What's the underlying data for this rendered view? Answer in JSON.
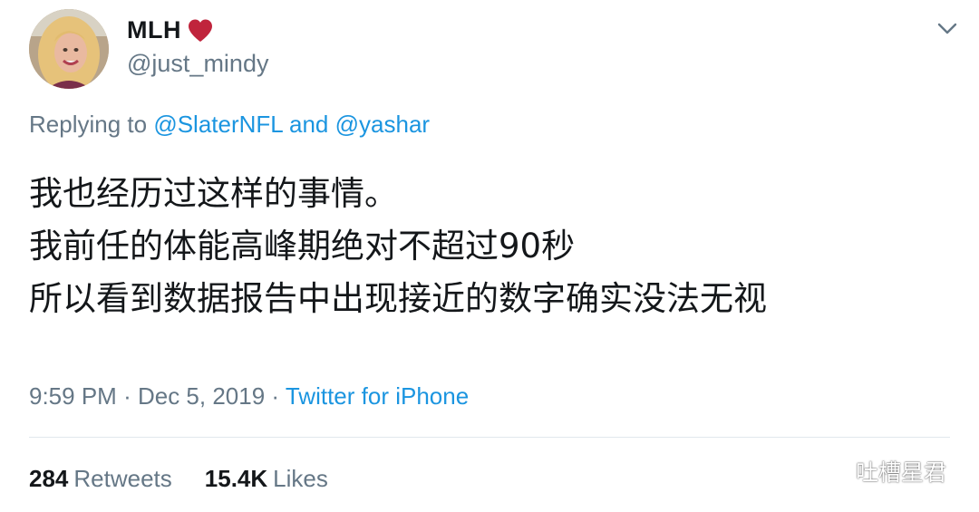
{
  "author": {
    "display_name": "MLH",
    "handle": "@just_mindy",
    "badge_icon": "heart-icon",
    "badge_color": "#c0243c"
  },
  "reply": {
    "prefix": "Replying to",
    "mention_1": "@SlaterNFL",
    "conjunction": "and",
    "mention_2": "@yashar"
  },
  "tweet": {
    "lines": [
      "我也经历过这样的事情。",
      "我前任的体能高峰期绝对不超过90秒",
      "所以看到数据报告中出现接近的数字确实没法无视"
    ]
  },
  "meta": {
    "time": "9:59 PM",
    "separator": "·",
    "date": "Dec 5, 2019",
    "source": "Twitter for iPhone"
  },
  "stats": {
    "retweets_count": "284",
    "retweets_label": "Retweets",
    "likes_count": "15.4K",
    "likes_label": "Likes"
  },
  "watermark": {
    "text": "吐槽星君",
    "icon": "wechat-icon"
  },
  "colors": {
    "link": "#1b95e0",
    "secondary": "#657786",
    "primary": "#14171a",
    "divider": "#e1e8ed"
  }
}
